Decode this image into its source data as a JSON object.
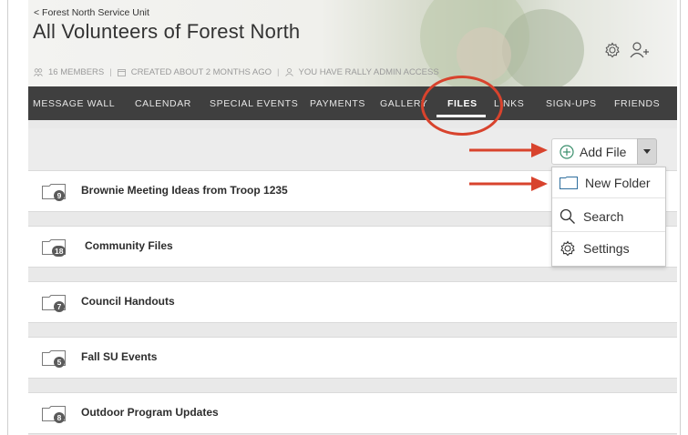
{
  "header": {
    "back_link": "< Forest North Service Unit",
    "title": "All Volunteers of Forest North",
    "meta": {
      "members": "16 MEMBERS",
      "created": "CREATED ABOUT 2 MONTHS AGO",
      "access": "YOU HAVE RALLY ADMIN ACCESS"
    }
  },
  "nav": {
    "items": [
      {
        "label": "MESSAGE WALL"
      },
      {
        "label": "CALENDAR"
      },
      {
        "label": "SPECIAL EVENTS"
      },
      {
        "label": "PAYMENTS"
      },
      {
        "label": "GALLERY"
      },
      {
        "label": "FILES",
        "active": true
      },
      {
        "label": "LINKS"
      },
      {
        "label": "SIGN-UPS"
      },
      {
        "label": "FRIENDS"
      }
    ]
  },
  "toolbar": {
    "add_file_label": "Add File"
  },
  "dropdown": {
    "items": [
      {
        "label": "New Folder",
        "icon": "folder-icon"
      },
      {
        "label": "Search",
        "icon": "search-icon"
      },
      {
        "label": "Settings",
        "icon": "gear-icon"
      }
    ]
  },
  "folders": [
    {
      "name": "Brownie Meeting Ideas from Troop 1235",
      "count": "9"
    },
    {
      "name": "Community Files",
      "count": "18"
    },
    {
      "name": "Council Handouts",
      "count": "7"
    },
    {
      "name": "Fall SU Events",
      "count": "5"
    },
    {
      "name": "Outdoor Program Updates",
      "count": "8"
    }
  ],
  "colors": {
    "nav_bg": "#3f3f3f",
    "annotation_red": "#d8432d",
    "accent_green": "#3a8f6c",
    "folder_blue": "#2f6f9e"
  }
}
